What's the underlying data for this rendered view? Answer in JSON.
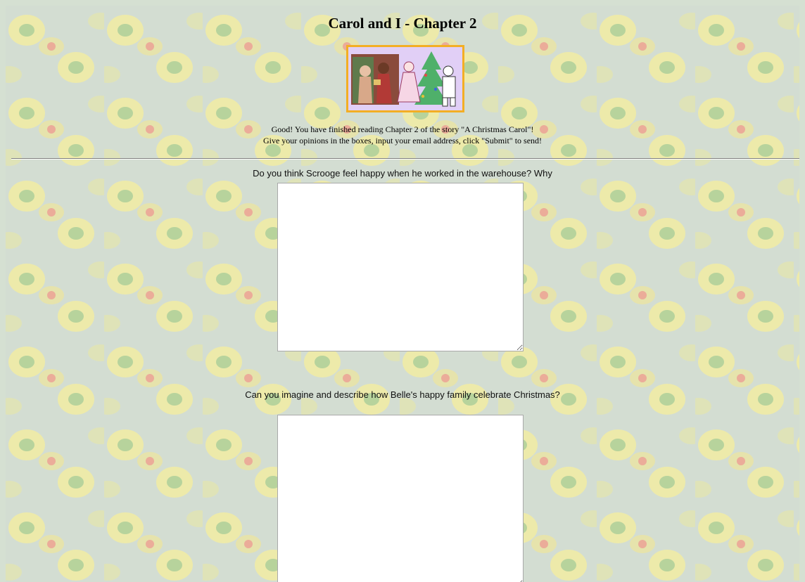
{
  "page": {
    "title": "Carol and I - Chapter 2",
    "intro_line_1": "Good! You have finished reading Chapter 2 of the story \"A Christmas Carol\"!",
    "intro_line_2": "Give your opinions in the boxes, input your email address, click \"Submit\" to send!"
  },
  "banner": {
    "icon": "christmas-tree-family-illustration"
  },
  "questions": [
    {
      "label": "Do you think Scrooge feel happy when he worked in the warehouse? Why",
      "answer_value": ""
    },
    {
      "label": "Can you imagine and describe how Belle's happy family celebrate Christmas?",
      "answer_value": ""
    }
  ],
  "colors": {
    "background_tint": "#d5e0d2",
    "pattern_yellow": "#f3ec9a",
    "pattern_green": "#b9d49a",
    "pattern_red": "#e9a89a",
    "banner_border": "#f3ae24",
    "banner_fill": "#b98be0"
  }
}
